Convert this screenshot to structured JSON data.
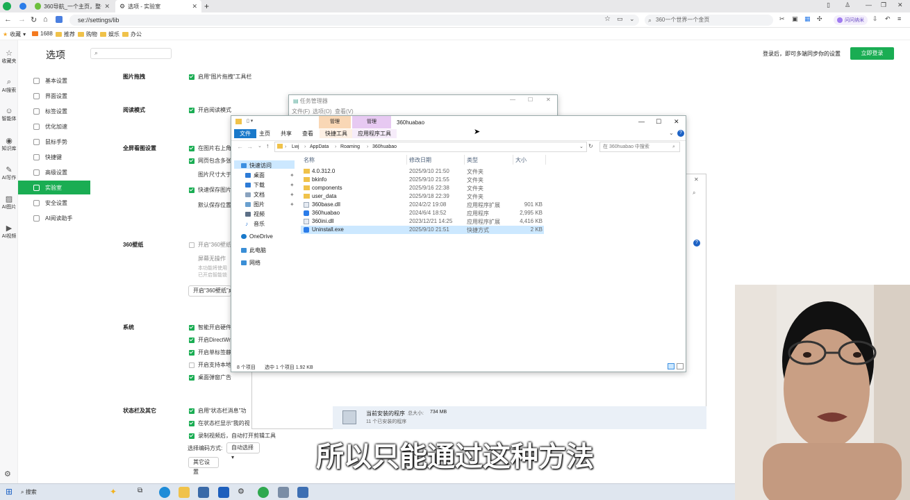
{
  "browser": {
    "tabs": [
      {
        "label": "360导航_一个主页，整个世..."
      },
      {
        "label": "选项 - 实验室"
      }
    ],
    "url": "se://settings/lib",
    "search_placeholder": "360一个世界一个金页",
    "user_badge": "问问纳米",
    "bookmarks": [
      "收藏",
      "1688",
      "推荐",
      "购物",
      "娱乐",
      "办公"
    ]
  },
  "rail": {
    "items": [
      "收藏夹",
      "AI搜索",
      "智能体",
      "知识库",
      "AI写作",
      "AI图片",
      "AI视频"
    ]
  },
  "settings": {
    "title": "选项",
    "login_hint": "登录后，即可多端同步你的设置",
    "login_button": "立即登录",
    "nav": [
      "基本设置",
      "界面设置",
      "标签设置",
      "优化加速",
      "鼠标手势",
      "快捷键",
      "高级设置",
      "实验室",
      "安全设置",
      "AI阅读助手"
    ],
    "sections": {
      "image_drag": {
        "label": "图片拖拽",
        "opt1": "启用“图片拖拽”工具栏"
      },
      "reading": {
        "label": "阅读模式",
        "opt1": "开启阅读模式"
      },
      "fullscreen": {
        "label": "全屏看图设置",
        "opt1": "在图片右上角",
        "opt2": "网页包含多张",
        "text1": "图片尺寸大于",
        "opt3": "快速保存图片",
        "text2": "默认保存位置"
      },
      "wallpaper": {
        "label": "360壁纸",
        "opt1": "开启“360壁纸",
        "text1": "屏幕无操作",
        "text2": "本功能将使用",
        "text3": "已开启智能锁",
        "button": "开启“360壁纸”桌"
      },
      "system": {
        "label": "系统",
        "opt1": "智能开启硬件",
        "opt2": "开启DirectWr",
        "opt3": "开启单标签静",
        "opt4": "开启支持本地",
        "opt5": "桌面弹窗广告"
      },
      "statusbar": {
        "label": "状态栏及其它",
        "opt1": "启用“状态栏消息”功",
        "opt2": "在状态栏显示“我的视",
        "opt3": "录制视频后，自动打开剪辑工具",
        "encoding_label": "选择编码方式:",
        "encoding_value": "自动选择",
        "other_button": "其它设置"
      }
    }
  },
  "task_manager": {
    "title": "任务管理器",
    "menu": [
      "文件(F)",
      "选项(O)",
      "查看(V)"
    ]
  },
  "programs_window": {
    "summary_title": "当前安装的程序",
    "total_label": "总大小:",
    "total_size": "734 MB",
    "count_text": "11 个已安装的程序"
  },
  "explorer": {
    "title": "360huabao",
    "context_tabs": [
      "管理",
      "管理"
    ],
    "ribbon_tabs": [
      "文件",
      "主页",
      "共享",
      "查看",
      "快捷工具",
      "应用程序工具"
    ],
    "path": [
      "Lwj",
      "AppData",
      "Roaming",
      "360huabao"
    ],
    "search_placeholder": "在 360huabao 中搜索",
    "columns": [
      "名称",
      "修改日期",
      "类型",
      "大小"
    ],
    "tree": [
      "快速访问",
      "桌面",
      "下载",
      "文档",
      "图片",
      "视频",
      "音乐",
      "OneDrive",
      "此电脑",
      "网络"
    ],
    "files": [
      {
        "name": "4.0.312.0",
        "date": "2025/9/10 21:50",
        "type": "文件夹",
        "size": "",
        "kind": "folder"
      },
      {
        "name": "bkinfo",
        "date": "2025/9/10 21:55",
        "type": "文件夹",
        "size": "",
        "kind": "folder"
      },
      {
        "name": "components",
        "date": "2025/9/16 22:38",
        "type": "文件夹",
        "size": "",
        "kind": "folder"
      },
      {
        "name": "user_data",
        "date": "2025/9/18 22:39",
        "type": "文件夹",
        "size": "",
        "kind": "folder"
      },
      {
        "name": "360base.dll",
        "date": "2024/2/2 19:08",
        "type": "应用程序扩展",
        "size": "901 KB",
        "kind": "file"
      },
      {
        "name": "360huabao",
        "date": "2024/6/4 18:52",
        "type": "应用程序",
        "size": "2,995 KB",
        "kind": "app"
      },
      {
        "name": "360ini.dll",
        "date": "2023/12/21 14:25",
        "type": "应用程序扩展",
        "size": "4,416 KB",
        "kind": "file"
      },
      {
        "name": "Uninstall.exe",
        "date": "2025/9/10 21:51",
        "type": "快捷方式",
        "size": "2 KB",
        "kind": "app"
      }
    ],
    "status_count": "8 个项目",
    "status_selected": "选中 1 个项目  1.92 KB"
  },
  "taskbar": {
    "search": "搜索"
  },
  "subtitle": "所以只能通过这种方法",
  "colors": {
    "accent": "#1aad53",
    "selection": "#cce8ff",
    "ribbon_file": "#1979ca"
  }
}
